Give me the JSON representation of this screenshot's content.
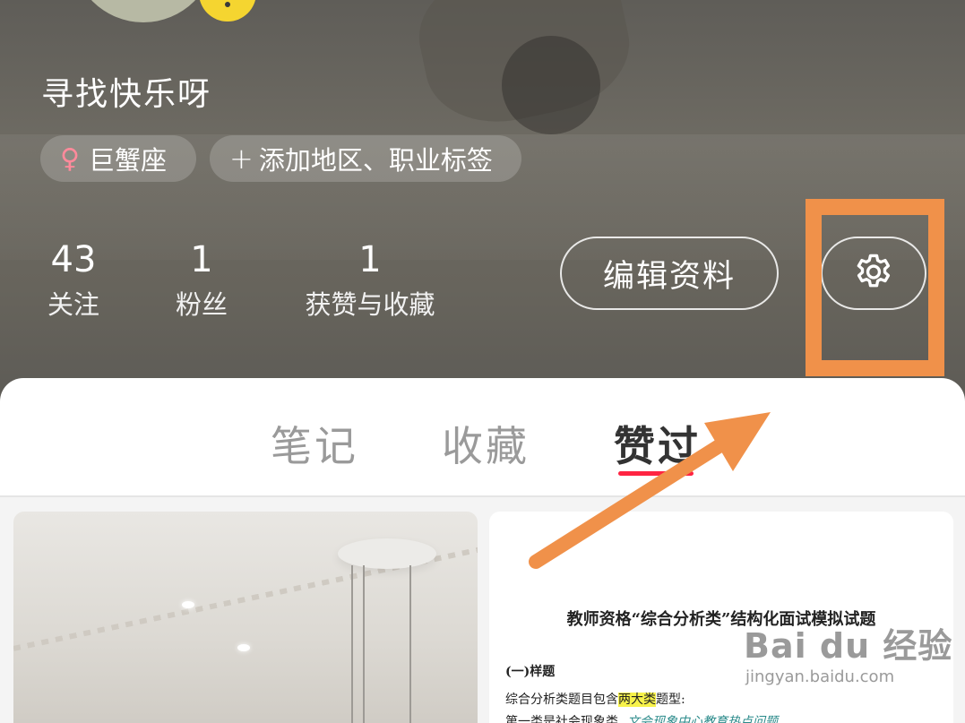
{
  "profile": {
    "username": "寻找快乐呀",
    "tags": [
      {
        "symbol": "♀",
        "label": "巨蟹座"
      },
      {
        "symbol": "+",
        "label": "添加地区、职业标签"
      }
    ],
    "stats": [
      {
        "value": "43",
        "label": "关注"
      },
      {
        "value": "1",
        "label": "粉丝"
      },
      {
        "value": "1",
        "label": "获赞与收藏"
      }
    ],
    "edit_label": "编辑资料",
    "settings_icon": "gear-icon"
  },
  "tabs": [
    {
      "label": "笔记",
      "active": false
    },
    {
      "label": "收藏",
      "active": false
    },
    {
      "label": "赞过",
      "active": true
    }
  ],
  "feed": {
    "doc_card": {
      "title": "教师资格“综合分析类”结构化面试模拟试题",
      "section": "(一)样题",
      "line1_pre": "综合分析类题目包含",
      "line1_highlight": "两大类",
      "line1_post": "题型:",
      "line2": "第一类是社会现象类",
      "line2_handwriting": "文会现象中心教育热点问题"
    }
  },
  "watermark": {
    "logo": "Bai du 经验",
    "url": "jingyan.baidu.com"
  },
  "colors": {
    "accent": "#ff2442",
    "annotation": "#f0914a",
    "zodiac": "#ff8a9b"
  }
}
